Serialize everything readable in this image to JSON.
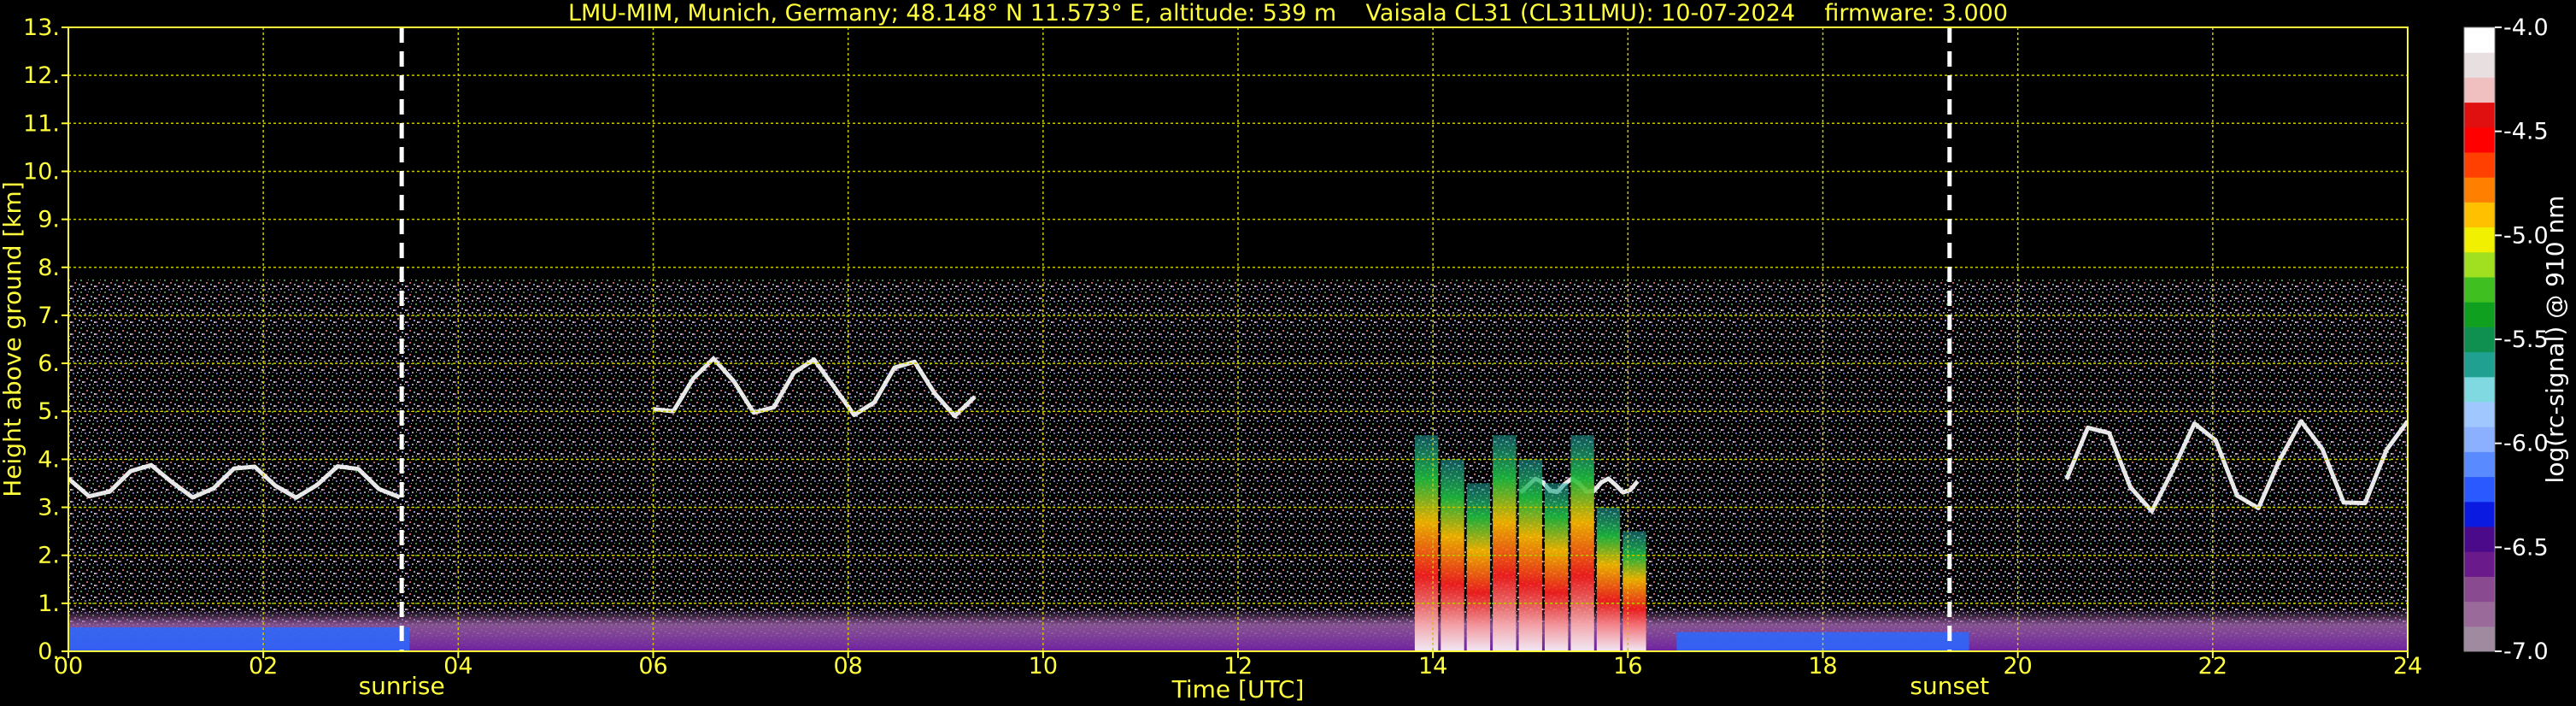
{
  "chart_data": {
    "type": "heatmap",
    "title": "LMU-MIM, Munich, Germany; 48.148° N 11.573° E, altitude: 539 m    Vaisala CL31 (CL31LMU): 10-07-2024    firmware: 3.000",
    "xlabel": "Time [UTC]",
    "ylabel": "Height above ground [km]",
    "xlim": [
      0,
      24
    ],
    "ylim": [
      0,
      13
    ],
    "x_tick_labels": [
      "00",
      "02",
      "04",
      "06",
      "08",
      "10",
      "12",
      "14",
      "16",
      "18",
      "20",
      "22",
      "24"
    ],
    "y_tick_labels": [
      "0.",
      "1.",
      "2.",
      "3.",
      "4.",
      "5.",
      "6.",
      "7.",
      "8.",
      "9.",
      "10.",
      "11.",
      "12.",
      "13."
    ],
    "grid": true,
    "grid_color": "#c8c800",
    "background": "#000000",
    "events": [
      {
        "name": "sunrise",
        "time": 3.42
      },
      {
        "name": "sunset",
        "time": 19.3
      }
    ],
    "colorbar": {
      "label": "log(rc-signal) @ 910 nm",
      "range": [
        -7.0,
        -4.0
      ],
      "tick_labels": [
        "-7.0",
        "-6.5",
        "-6.0",
        "-5.5",
        "-5.0",
        "-4.5",
        "-4.0"
      ],
      "colors": [
        "#a08aa0",
        "#9a6a9a",
        "#8a4a90",
        "#6a1a8a",
        "#4a0a8a",
        "#0a1ae0",
        "#2a5aff",
        "#5a8aff",
        "#8ab0ff",
        "#a0c8ff",
        "#80d8e0",
        "#20a090",
        "#109050",
        "#10a020",
        "#40c020",
        "#a0e020",
        "#f0f000",
        "#ffc000",
        "#ff8000",
        "#ff4000",
        "#ff0000",
        "#e01010",
        "#f0c0c0",
        "#e8e0e0",
        "#ffffff"
      ]
    },
    "noise_top_km": 7.75,
    "features": [
      {
        "kind": "aerosol_layer",
        "x": [
          0,
          24
        ],
        "y": [
          0,
          0.9
        ],
        "color": "#9040a0"
      },
      {
        "kind": "boundary_layer",
        "x": [
          0,
          3.5
        ],
        "y": [
          0,
          0.5
        ],
        "color": "#2a6aff"
      },
      {
        "kind": "boundary_layer",
        "x": [
          16.5,
          19.5
        ],
        "y": [
          0,
          0.4
        ],
        "color": "#2a6aff"
      },
      {
        "kind": "cloud_layer",
        "x": [
          0,
          3.4
        ],
        "y": [
          3.2,
          3.9
        ],
        "color": "#ffffff"
      },
      {
        "kind": "cloud_layer",
        "x": [
          6.0,
          9.3
        ],
        "y": [
          4.9,
          6.1
        ],
        "color": "#ffffff"
      },
      {
        "kind": "cloud_layer",
        "x": [
          14.9,
          16.1
        ],
        "y": [
          3.3,
          3.6
        ],
        "color": "#ffffff"
      },
      {
        "kind": "cloud_layer",
        "x": [
          20.5,
          24
        ],
        "y": [
          2.9,
          4.8
        ],
        "color": "#ffffff"
      },
      {
        "kind": "convective_cloud",
        "x": [
          13.8,
          16.2
        ],
        "y": [
          0,
          4.5
        ],
        "color": "#ff2020"
      }
    ]
  }
}
